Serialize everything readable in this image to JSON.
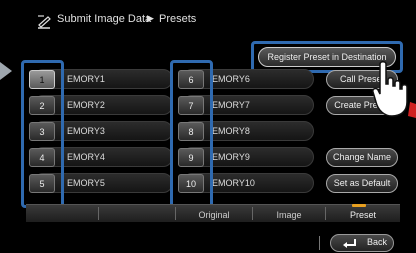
{
  "header": {
    "title": "Submit Image Data",
    "separator": "▶",
    "subtitle": "Presets"
  },
  "top_action": {
    "label": "Register Preset in Destination"
  },
  "presets_left": [
    {
      "number": "1",
      "label": "EMORY1",
      "active": true
    },
    {
      "number": "2",
      "label": "EMORY2",
      "active": false
    },
    {
      "number": "3",
      "label": "EMORY3",
      "active": false
    },
    {
      "number": "4",
      "label": "EMORY4",
      "active": false
    },
    {
      "number": "5",
      "label": "EMORY5",
      "active": false
    }
  ],
  "presets_right": [
    {
      "number": "6",
      "label": "EMORY6",
      "active": false
    },
    {
      "number": "7",
      "label": "EMORY7",
      "active": false
    },
    {
      "number": "8",
      "label": "EMORY8",
      "active": false
    },
    {
      "number": "9",
      "label": "EMORY9",
      "active": false
    },
    {
      "number": "10",
      "label": "EMORY10",
      "active": false
    }
  ],
  "side_buttons": {
    "call_preset": "Call Preset",
    "create_preset": "Create Preset",
    "change_name": "Change Name",
    "set_default": "Set as Default"
  },
  "tabs": [
    {
      "label": ""
    },
    {
      "label": ""
    },
    {
      "label": "Original"
    },
    {
      "label": "Image"
    },
    {
      "label": "Preset",
      "selected": true
    }
  ],
  "footer": {
    "back_label": "Back"
  },
  "colors": {
    "highlight_blue": "#2f6ab0",
    "selected_tab_marker": "#e8a020"
  },
  "icons": {
    "header": "submit-image-data-icon",
    "arrow": "pointer-arrow-icon",
    "back": "return-arrow-icon",
    "hand": "pointing-hand-icon"
  }
}
